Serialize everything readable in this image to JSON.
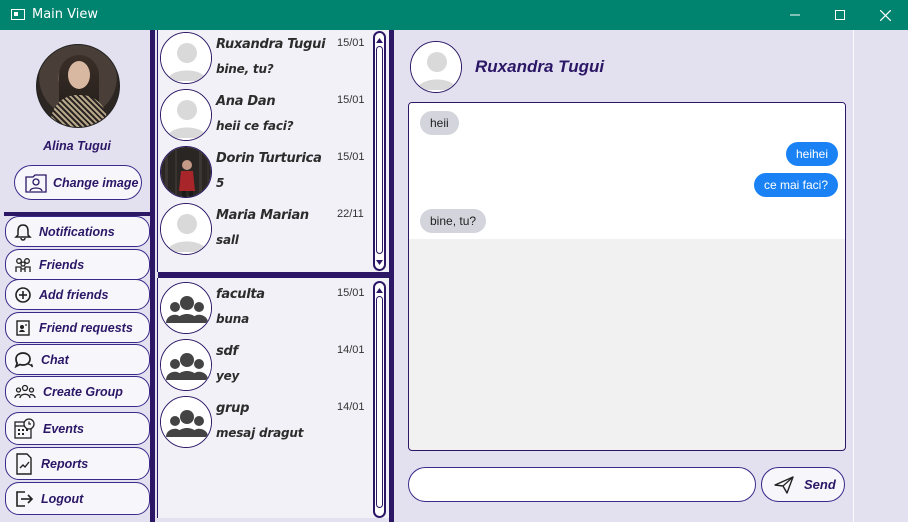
{
  "window": {
    "title": "Main View"
  },
  "profile": {
    "name": "Alina Tugui",
    "change_image_label": "Change image"
  },
  "nav": [
    {
      "label": "Notifications",
      "icon": "bell-icon"
    },
    {
      "label": "Friends",
      "icon": "friends-icon"
    },
    {
      "label": "Add friends",
      "icon": "plus-circle-icon"
    },
    {
      "label": "Friend requests",
      "icon": "request-icon"
    },
    {
      "label": "Chat",
      "icon": "chat-icon"
    },
    {
      "label": "Create Group",
      "icon": "group-icon"
    },
    {
      "label": "Events",
      "icon": "calendar-clock-icon"
    },
    {
      "label": "Reports",
      "icon": "report-icon"
    },
    {
      "label": "Logout",
      "icon": "logout-icon"
    }
  ],
  "conversations": [
    {
      "name": "Ruxandra Tugui",
      "last_message": "bine, tu?",
      "date": "15/01",
      "avatar": "default"
    },
    {
      "name": "Ana Dan",
      "last_message": "heii ce faci?",
      "date": "15/01",
      "avatar": "default"
    },
    {
      "name": "Dorin Turturica",
      "last_message": "5",
      "date": "15/01",
      "avatar": "photo"
    },
    {
      "name": "Maria Marian",
      "last_message": "sall",
      "date": "22/11",
      "avatar": "default"
    }
  ],
  "groups": [
    {
      "name": "faculta",
      "last_message": "buna",
      "date": "15/01"
    },
    {
      "name": "sdf",
      "last_message": "yey",
      "date": "14/01"
    },
    {
      "name": "grup",
      "last_message": "mesaj dragut",
      "date": "14/01"
    }
  ],
  "chat": {
    "contact_name": "Ruxandra Tugui",
    "messages": [
      {
        "text": "heii",
        "direction": "incoming"
      },
      {
        "text": "heihei",
        "direction": "outgoing"
      },
      {
        "text": "ce mai faci?",
        "direction": "outgoing"
      },
      {
        "text": "bine, tu?",
        "direction": "incoming"
      }
    ],
    "input_value": "",
    "send_label": "Send"
  },
  "colors": {
    "titlebar": "#00836f",
    "accent": "#2b1766",
    "panel_bg": "#e3e0ef",
    "outgoing_bubble": "#1a82f5",
    "incoming_bubble": "#d4d4dd"
  }
}
